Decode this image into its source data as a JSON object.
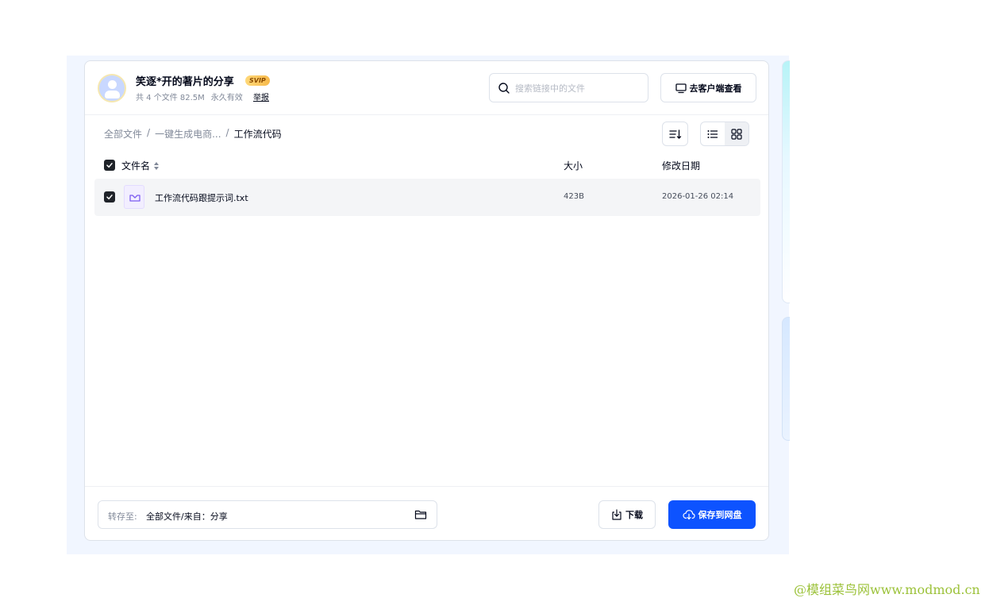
{
  "header": {
    "share_title": "笑逐*开的著片的分享",
    "svip_badge": "SVIP",
    "meta_count": "共 4 个文件 82.5M",
    "meta_validity": "永久有效",
    "report_link": "举报",
    "search_placeholder": "搜索链接中的文件",
    "client_button": "去客户端查看"
  },
  "breadcrumb": {
    "items": [
      "全部文件",
      "一键生成电商...",
      "工作流代码"
    ],
    "separator": "/"
  },
  "table": {
    "columns": {
      "name": "文件名",
      "size": "大小",
      "date": "修改日期"
    },
    "rows": [
      {
        "name": "工作流代码跟提示词.txt",
        "size": "423B",
        "date": "2026-01-26 02:14",
        "checked": true
      }
    ]
  },
  "footer": {
    "save_label": "转存至:",
    "save_value": "全部文件/来自：分享",
    "download_button": "下载",
    "save_button": "保存到网盘"
  },
  "watermark": "@模组菜鸟网www.modmod.cn",
  "colors": {
    "primary": "#0d53ff",
    "text": "#03081a",
    "muted": "#818999",
    "border": "#dde2ea"
  }
}
